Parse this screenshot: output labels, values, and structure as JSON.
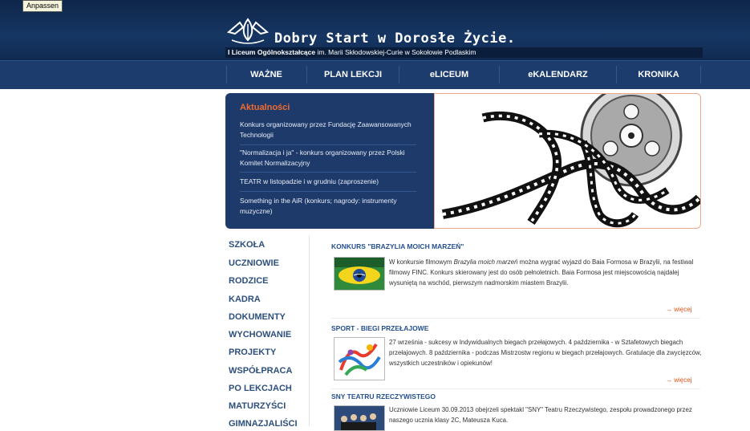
{
  "tooltip": "Anpassen",
  "header": {
    "site_title": "Dobry Start w Dorosłe Życie.",
    "subtitle_bold": "I Liceum Ogólnokształcące",
    "subtitle_rest": " im. Marii Skłodowskiej-Curie w Sokołowie Podlaskim"
  },
  "nav": {
    "items": [
      {
        "label": "WAŻNE"
      },
      {
        "label": "PLAN LEKCJI"
      },
      {
        "label": "eLICEUM"
      },
      {
        "label": "eKALENDARZ"
      },
      {
        "label": "KRONIKA"
      }
    ]
  },
  "news": {
    "title": "Aktualności",
    "items": [
      {
        "text": "Konkurs organizowany przez Fundację Zaawansowanych Technologii"
      },
      {
        "text": "\"Normalizacja i ja\" - konkurs organizowany przez Polski Komitet Normalizacyjny"
      },
      {
        "text": "TEATR w listopadzie i w grudniu (zaproszenie)"
      },
      {
        "text": "Something in the AiR (konkurs; nagrody: instrumenty muzyczne)"
      }
    ]
  },
  "sidebar": {
    "items": [
      {
        "label": "SZKOŁA"
      },
      {
        "label": "UCZNIOWIE"
      },
      {
        "label": "RODZICE"
      },
      {
        "label": "KADRA"
      },
      {
        "label": "DOKUMENTY"
      },
      {
        "label": "WYCHOWANIE"
      },
      {
        "label": "PROJEKTY"
      },
      {
        "label": "WSPÓŁPRACA"
      },
      {
        "label": "PO LEKCJACH"
      },
      {
        "label": "MATURZYŚCI"
      },
      {
        "label": "GIMNAZJALIŚCI"
      }
    ]
  },
  "articles": [
    {
      "title": "KONKURS \"BRAZYLIA MOICH MARZEŃ\"",
      "text_a": "W konkursie filmowym ",
      "text_italic": "Brazylia moich marzeń",
      "text_b": " można wygrać wyjazd do Baia Formosa w Brazylii, na festiwal filmowy FINC. Konkurs skierowany jest do osób pełnoletnich. Baia Formosa jest miejscowością najdalej wysuniętą na wschód, pierwszym nadmorskim miastem  Brazylii.",
      "more": "→ więcej"
    },
    {
      "title": "SPORT - BIEGI PRZEŁAJOWE",
      "text": "27 września - sukcesy w Indywidualnych biegach przełajowych. 4 października - w Sztafetowych biegach przełajowych. 8 października - podczas Mistrzostw regionu w biegach przełajowych. Gratulacje dla zwycięzców, wszystkich uczestników i opiekunów!",
      "more": "→ więcej"
    },
    {
      "title": "SNY TEATRU RZECZYWISTEGO",
      "text": "Uczniowie Liceum 30.09.2013 obejrzeli spektakl \"SNY\" Teatru Rzeczywistego, zespołu prowadzonego przez naszego ucznia klasy 2C, Mateusza Kuca."
    }
  ],
  "colors": {
    "header_bg": "#163663",
    "nav_bg": "#1b3c6d",
    "news_bg": "#1d3a6a",
    "accent_orange": "#f26a2e",
    "sidebar_link": "#2d4f7e",
    "article_title": "#245091"
  }
}
